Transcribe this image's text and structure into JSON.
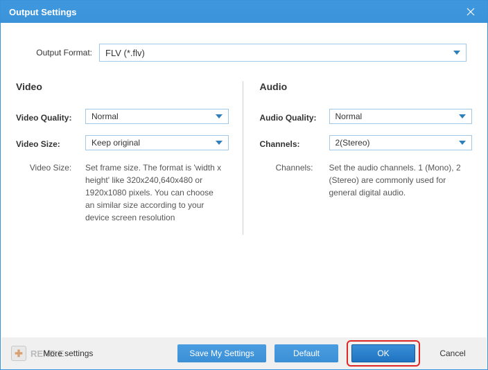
{
  "title": "Output Settings",
  "output_format": {
    "label": "Output Format:",
    "value": "FLV (*.flv)"
  },
  "video": {
    "heading": "Video",
    "quality_label": "Video Quality:",
    "quality_value": "Normal",
    "size_label": "Video Size:",
    "size_value": "Keep original",
    "desc_label": "Video Size:",
    "desc_text": "Set frame size. The format is 'width x height' like 320x240,640x480 or 1920x1080 pixels. You can choose an similar size according to your device screen resolution"
  },
  "audio": {
    "heading": "Audio",
    "quality_label": "Audio Quality:",
    "quality_value": "Normal",
    "channels_label": "Channels:",
    "channels_value": "2(Stereo)",
    "desc_label": "Channels:",
    "desc_text": "Set the audio channels. 1 (Mono), 2 (Stereo) are commonly used for general digital audio."
  },
  "footer": {
    "watermark": "RENE.E",
    "more_settings": "More settings",
    "save": "Save My Settings",
    "default": "Default",
    "ok": "OK",
    "cancel": "Cancel"
  }
}
